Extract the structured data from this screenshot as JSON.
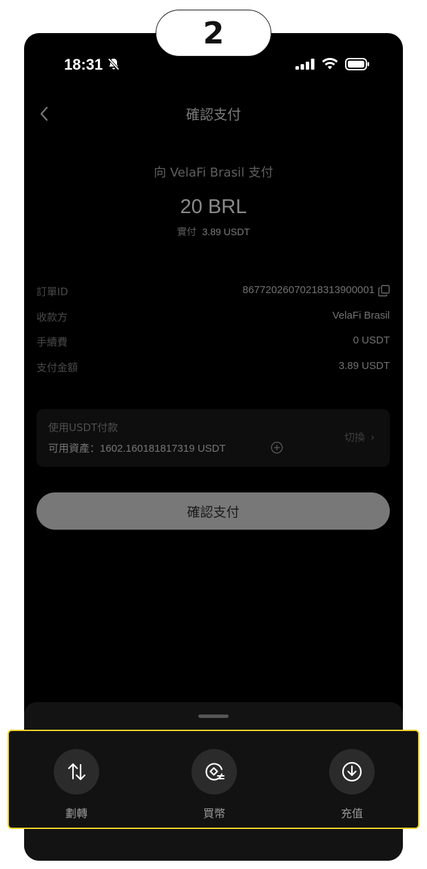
{
  "step_badge": "2",
  "status_bar": {
    "time": "18:31"
  },
  "header": {
    "title": "確認支付"
  },
  "payment": {
    "pay_to": "向 VelaFi Brasil 支付",
    "amount": "20 BRL",
    "actual_label": "實付",
    "actual_value": "3.89 USDT"
  },
  "details": [
    {
      "key": "訂單ID",
      "value": "86772026070218313900001"
    },
    {
      "key": "收款方",
      "value": "VelaFi Brasil"
    },
    {
      "key": "手續費",
      "value": "0 USDT"
    },
    {
      "key": "支付金額",
      "value": "3.89 USDT"
    }
  ],
  "pay_method": {
    "method_label": "使用USDT付款",
    "available_label": "可用資產：",
    "available_value": "1602.160181817319 USDT",
    "switch_label": "切換"
  },
  "confirm_button": "確認支付",
  "bottom_actions": [
    {
      "label": "劃轉",
      "icon": "transfer-icon"
    },
    {
      "label": "買幣",
      "icon": "buy-crypto-icon"
    },
    {
      "label": "充值",
      "icon": "deposit-icon"
    }
  ],
  "colors": {
    "highlight": "#f2d22a",
    "background": "#000000",
    "button": "#787878"
  }
}
